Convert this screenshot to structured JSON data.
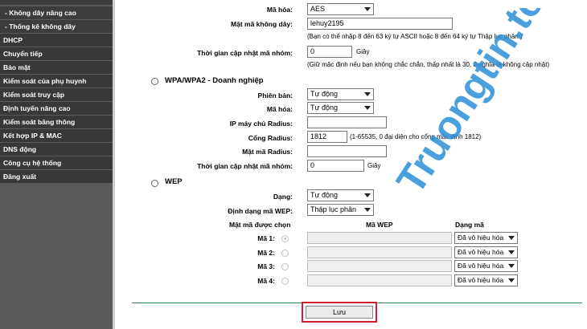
{
  "sidebar": {
    "items": [
      {
        "label": "- Không dây nâng cao"
      },
      {
        "label": "- Thống kê không dây"
      },
      {
        "label": "DHCP"
      },
      {
        "label": "Chuyển tiếp"
      },
      {
        "label": "Bảo mật"
      },
      {
        "label": "Kiểm soát của phụ huynh"
      },
      {
        "label": "Kiểm soát truy cập"
      },
      {
        "label": "Định tuyến nâng cao"
      },
      {
        "label": "Kiểm soát băng thông"
      },
      {
        "label": "Kết hợp IP & MAC"
      },
      {
        "label": "DNS động"
      },
      {
        "label": "Công cụ hệ thống"
      },
      {
        "label": "Đăng xuất"
      }
    ]
  },
  "personal": {
    "encryption_label": "Mã hóa:",
    "encryption_value": "AES",
    "password_label": "Mật mã không dây:",
    "password_value": "lehuy2195",
    "password_hint": "(Bạn có thể nhập 8 đến 63 ký tự ASCII hoặc 8 đến 64 ký tự Thập lục phân.)",
    "group_key_label": "Thời gian cập nhật mã nhóm:",
    "group_key_value": "0",
    "group_key_unit": "Giây",
    "group_key_hint": "(Giữ mặc định nếu bạn không chắc chắn, thấp nhất là 30, 0 nghĩa là không cập nhật)"
  },
  "enterprise": {
    "title": "WPA/WPA2 - Doanh nghiệp",
    "version_label": "Phiên bản:",
    "version_value": "Tự động",
    "encryption_label": "Mã hóa:",
    "encryption_value": "Tự động",
    "radius_ip_label": "IP máy chủ Radius:",
    "radius_ip_value": "",
    "radius_port_label": "Cổng Radius:",
    "radius_port_value": "1812",
    "radius_port_hint": "(1-65535, 0 đại diện cho cổng mặc định 1812)",
    "radius_pass_label": "Mật mã Radius:",
    "radius_pass_value": "",
    "group_key_label": "Thời gian cập nhật mã nhóm:",
    "group_key_value": "0",
    "group_key_unit": "Giây"
  },
  "wep": {
    "title": "WEP",
    "type_label": "Dạng:",
    "type_value": "Tự động",
    "format_label": "Định dạng mã WEP:",
    "format_value": "Thập lục phân",
    "col_selected": "Mật mã được chọn",
    "col_key": "Mã WEP",
    "col_type": "Dạng mã",
    "keys": [
      {
        "label": "Mã 1:",
        "value": "",
        "type": "Đã vô hiệu hóa"
      },
      {
        "label": "Mã 2:",
        "value": "",
        "type": "Đã vô hiệu hóa"
      },
      {
        "label": "Mã 3:",
        "value": "",
        "type": "Đã vô hiệu hóa"
      },
      {
        "label": "Mã 4:",
        "value": "",
        "type": "Đã vô hiệu hóa"
      }
    ]
  },
  "save_label": "Lưu",
  "watermark": {
    "text": "Truongtin.top"
  },
  "colors": {
    "sidebar": "#383838",
    "highlight": "#d0202a",
    "watermark": "#2a8fd6"
  }
}
